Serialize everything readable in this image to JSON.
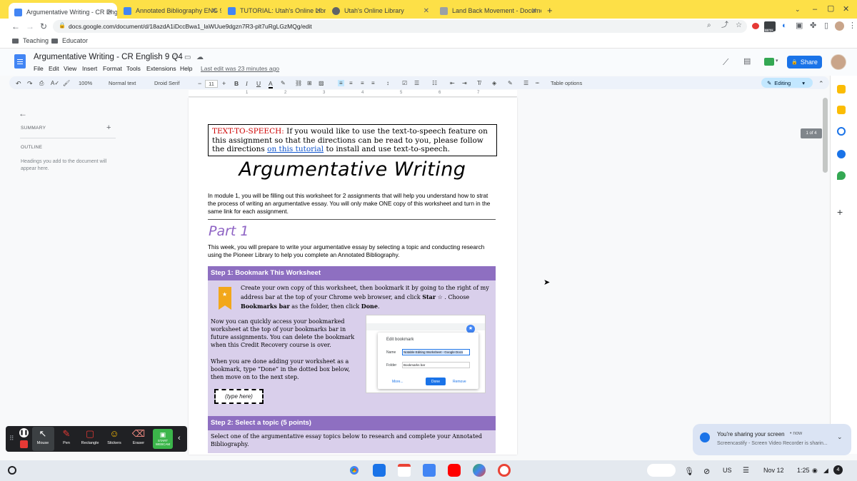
{
  "browser": {
    "tabs": [
      {
        "title": "Argumentative Writing - CR Engli",
        "active": true,
        "favicon": "docs-icon"
      },
      {
        "title": "Annotated Bibliography ENG 9CR",
        "active": false,
        "favicon": "docs-icon"
      },
      {
        "title": "TUTORIAL: Utah's Online Library",
        "active": false,
        "favicon": "docs-icon"
      },
      {
        "title": "Utah's Online Library",
        "active": false,
        "favicon": "globe-icon"
      },
      {
        "title": "Land Back Movement - Docume",
        "active": false,
        "favicon": "movie-icon"
      }
    ],
    "url": "docs.google.com/document/d/18azdA1iDccBwa1_laWUue9dgzn7R3-plt7uRgLGzMQg/edit",
    "bookmarks": [
      "Teaching",
      "Educator"
    ],
    "extension_badge": "BETA"
  },
  "docs": {
    "title": "Argumentative Writing - CR English 9 Q4",
    "menus": [
      "File",
      "Edit",
      "View",
      "Insert",
      "Format",
      "Tools",
      "Extensions",
      "Help"
    ],
    "last_edit": "Last edit was 23 minutes ago",
    "share_label": "Share",
    "toolbar": {
      "zoom": "100%",
      "style": "Normal text",
      "font": "Droid Serif",
      "size": "11",
      "table_options": "Table options",
      "mode": "Editing"
    },
    "ruler_marks": [
      "1",
      "1",
      "2",
      "3",
      "4",
      "5",
      "6",
      "7"
    ],
    "outline_panel": {
      "summary_label": "SUMMARY",
      "outline_label": "OUTLINE",
      "hint": "Headings you add to the document will appear here."
    },
    "page_badge": "1 of 4"
  },
  "document": {
    "tts_label": "TEXT-TO-SPEECH:",
    "tts_text_1": " If you would like to use the text-to-speech feature on this assignment so that the directions can be read to you, please follow the directions ",
    "tts_link": "on this tutorial",
    "tts_text_2": " to install and use text-to-speech.",
    "heading": "Argumentative Writing",
    "intro": "In module 1, you will be filling out this worksheet for 2 assignments that will help you understand how to strat the process of writing an argumentative essay. You will only make ONE copy of this worksheet and turn in the same link for each assignment.",
    "part_title": "Part 1",
    "part_text": "This week, you will prepare to write your argumentative essay by selecting a topic and conducting research using the Pioneer Library to help you complete an Annotated Bibliography.",
    "step1_title": "Step 1: Bookmark This Worksheet",
    "step1_p1_a": "Create your own copy of this worksheet, then bookmark it by going to the right of my address bar at the top of your Chrome web browser, and click ",
    "step1_p1_star": "Star",
    "step1_p1_b": " . Choose ",
    "step1_p1_bm": "Bookmarks bar",
    "step1_p1_c": " as the folder, then click ",
    "step1_p1_done": "Done",
    "step1_p1_d": ".",
    "step1_p2": "Now you can quickly access your bookmarked worksheet at the top of your bookmarks bar in future assignments. You can delete the bookmark when this Credit Recovery course is over.",
    "step1_p3": "When you are done adding your worksheet as a bookmark, type “Done” in the dotted box below, then move on to the next step.",
    "type_here": "(type here)",
    "screenshot": {
      "dialog_title": "Edit bookmark",
      "name_label": "Name",
      "name_value": "Notable Editing Worksheet - Google Docs",
      "folder_label": "Folder",
      "folder_value": "Bookmarks bar",
      "more": "More...",
      "done": "Done",
      "remove": "Remove"
    },
    "step2_title": "Step 2: Select a topic (5 points)",
    "step2_text": "Select one of the argumentative essay topics below to research and complete your Annotated Bibliography."
  },
  "screencastify": {
    "tools": [
      {
        "label": "Mouse",
        "icon": "cursor-icon"
      },
      {
        "label": "Pen",
        "icon": "pen-icon"
      },
      {
        "label": "Rectangle",
        "icon": "rectangle-icon"
      },
      {
        "label": "Stickers",
        "icon": "sticker-icon"
      },
      {
        "label": "Eraser",
        "icon": "eraser-icon"
      }
    ],
    "webcam": "START WEBCAM"
  },
  "notification": {
    "title": "You're sharing your screen",
    "time": "• now",
    "body": "Screencastify - Screen Video Recorder is sharin..."
  },
  "shelf": {
    "input": "US",
    "date": "Nov 12",
    "time": "1:25",
    "battery": "4"
  }
}
